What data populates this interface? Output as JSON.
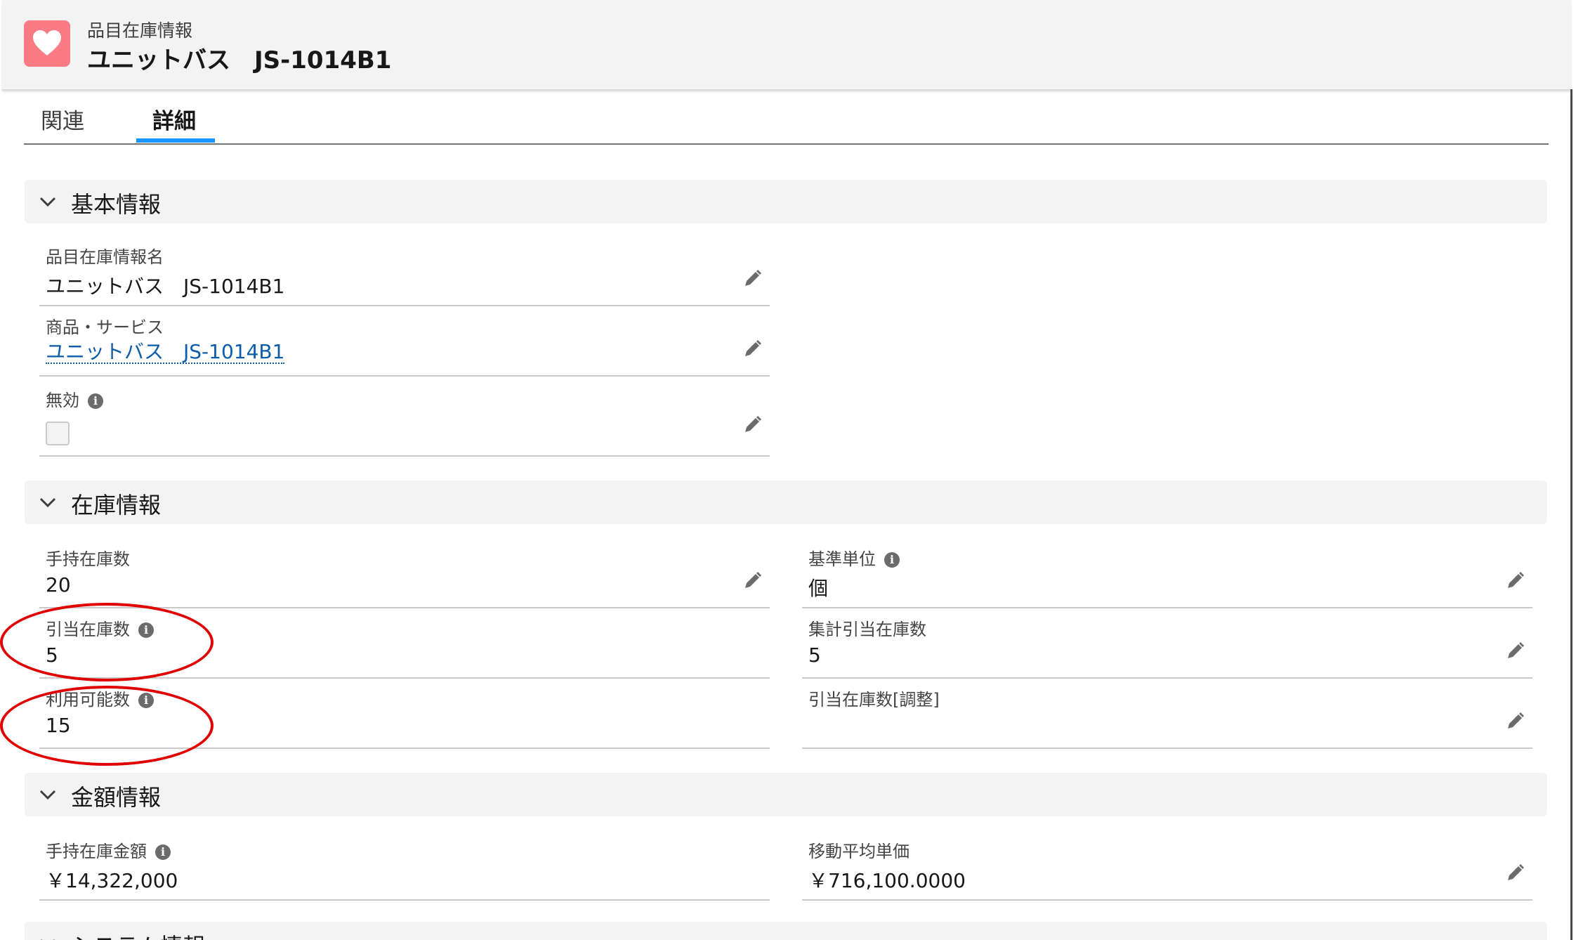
{
  "header": {
    "object_label": "品目在庫情報",
    "record_title": "ユニットバス　JS-1014B1",
    "icon": "heart-icon",
    "icon_color": "#fb7b85"
  },
  "tabs": [
    {
      "label": "関連",
      "active": false
    },
    {
      "label": "詳細",
      "active": true
    }
  ],
  "sections": {
    "basic": {
      "title": "基本情報",
      "fields": {
        "name": {
          "label": "品目在庫情報名",
          "value": "ユニットバス　JS-1014B1"
        },
        "product": {
          "label": "商品・サービス",
          "value": "ユニットバス　JS-1014B1"
        },
        "inactive": {
          "label": "無効",
          "checked": false
        }
      }
    },
    "stock": {
      "title": "在庫情報",
      "fields": {
        "on_hand": {
          "label": "手持在庫数",
          "value": "20"
        },
        "unit": {
          "label": "基準単位",
          "value": "個"
        },
        "allocated": {
          "label": "引当在庫数",
          "value": "5"
        },
        "aggregate_allocated": {
          "label": "集計引当在庫数",
          "value": "5"
        },
        "available": {
          "label": "利用可能数",
          "value": "15"
        },
        "allocated_adjust": {
          "label": "引当在庫数[調整]",
          "value": ""
        }
      }
    },
    "amount": {
      "title": "金額情報",
      "fields": {
        "on_hand_amount": {
          "label": "手持在庫金額",
          "value": "￥14,322,000"
        },
        "moving_avg_price": {
          "label": "移動平均単価",
          "value": "￥716,100.0000"
        }
      }
    },
    "system": {
      "title": "システム情報"
    }
  },
  "colors": {
    "accent": "#1b96ff",
    "link": "#0b5cab",
    "annotation": "#e00000"
  }
}
